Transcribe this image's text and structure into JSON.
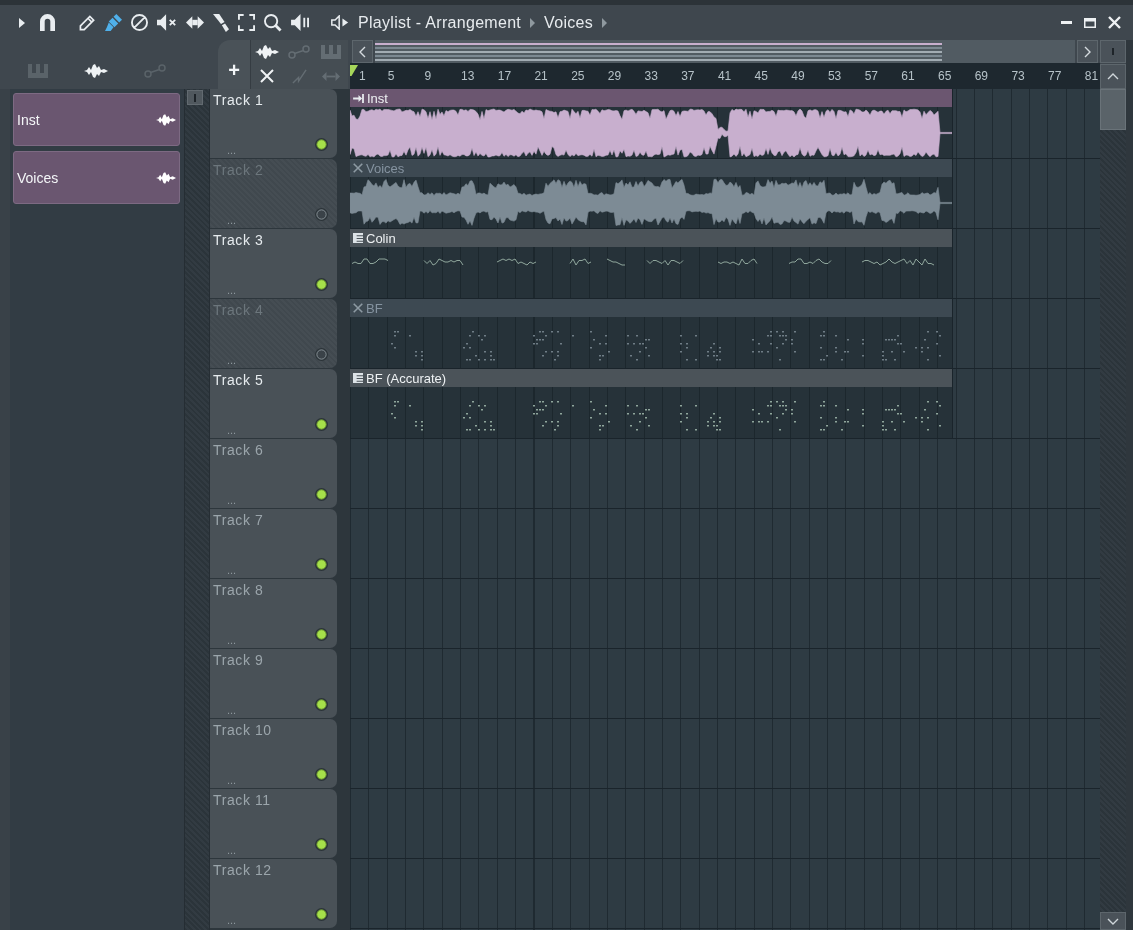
{
  "window": {
    "title": "Playlist - Arrangement",
    "breadcrumb": [
      "Voices"
    ]
  },
  "toolbar": [
    {
      "kind": "menu",
      "selected": false
    },
    {
      "kind": "snap",
      "selected": false
    },
    {
      "kind": "draw",
      "selected": false
    },
    {
      "kind": "paint",
      "selected": true
    },
    {
      "kind": "delete",
      "selected": false
    },
    {
      "kind": "mute",
      "selected": false
    },
    {
      "kind": "slip",
      "selected": false
    },
    {
      "kind": "slice",
      "selected": false
    },
    {
      "kind": "select",
      "selected": false
    },
    {
      "kind": "zoom",
      "selected": false
    },
    {
      "kind": "playback",
      "selected": false
    }
  ],
  "browser": {
    "filters": [
      {
        "kind": "pattern",
        "selected": false
      },
      {
        "kind": "audio",
        "selected": true
      },
      {
        "kind": "automation",
        "selected": false
      }
    ],
    "clips": [
      {
        "name": "Inst",
        "kind": "audio"
      },
      {
        "name": "Voices",
        "kind": "audio"
      }
    ]
  },
  "add_button": "+",
  "clip_tools": [
    {
      "kind": "audio",
      "disabled": false
    },
    {
      "kind": "automation",
      "disabled": true
    },
    {
      "kind": "pattern",
      "disabled": true
    },
    {
      "kind": "cross",
      "disabled": false
    },
    {
      "kind": "ramp",
      "disabled": true
    },
    {
      "kind": "stretch",
      "disabled": true
    }
  ],
  "ruler": [
    "1",
    "5",
    "9",
    "13",
    "17",
    "21",
    "25",
    "29",
    "33",
    "37",
    "41",
    "45",
    "49",
    "53",
    "57",
    "61",
    "65",
    "69",
    "73",
    "77",
    "81"
  ],
  "tracks": [
    {
      "name": "Track 1",
      "more": "...",
      "muted": false,
      "clip": {
        "name": "Inst",
        "kind": "audio",
        "muted": false,
        "color": "#6b5670"
      }
    },
    {
      "name": "Track 2",
      "more": "...",
      "muted": true,
      "clip": {
        "name": "Voices",
        "kind": "audio",
        "muted": true
      }
    },
    {
      "name": "Track 3",
      "more": "...",
      "muted": false,
      "clip": {
        "name": "Colin",
        "kind": "pattern",
        "muted": false,
        "color": "#4b5359"
      }
    },
    {
      "name": "Track 4",
      "more": "...",
      "muted": true,
      "clip": {
        "name": "BF",
        "kind": "pattern",
        "muted": true
      }
    },
    {
      "name": "Track 5",
      "more": "...",
      "muted": false,
      "clip": {
        "name": "BF (Accurate)",
        "kind": "pattern",
        "muted": false,
        "color": "#4b5359"
      }
    },
    {
      "name": "Track 6",
      "more": "...",
      "muted": false
    },
    {
      "name": "Track 7",
      "more": "...",
      "muted": false
    },
    {
      "name": "Track 8",
      "more": "...",
      "muted": false
    },
    {
      "name": "Track 9",
      "more": "...",
      "muted": false
    },
    {
      "name": "Track 10",
      "more": "...",
      "muted": false
    },
    {
      "name": "Track 11",
      "more": "...",
      "muted": false
    },
    {
      "name": "Track 12",
      "more": "...",
      "muted": false
    }
  ]
}
